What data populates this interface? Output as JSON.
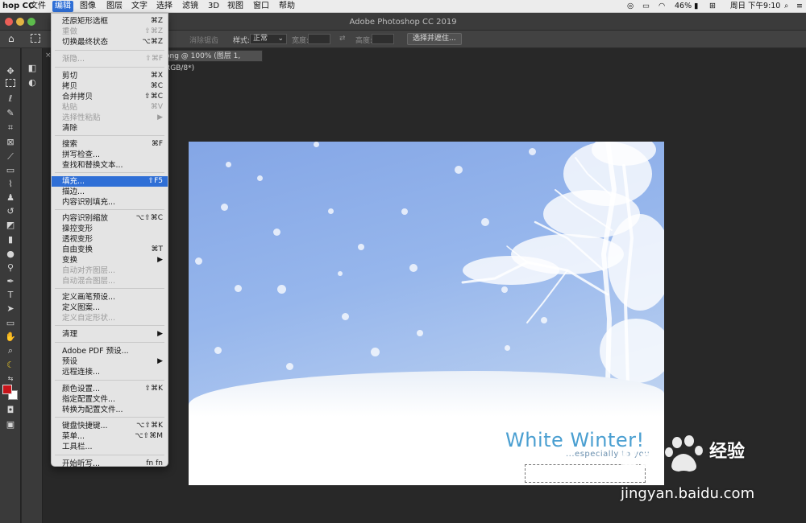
{
  "menubar": {
    "app": "hop CC",
    "items": [
      "文件",
      "编辑",
      "图像",
      "图层",
      "文字",
      "选择",
      "滤镜",
      "3D",
      "视图",
      "窗口",
      "帮助"
    ],
    "battery": "46%",
    "clock": "周日 下午9:10"
  },
  "window": {
    "title": "Adobe Photoshop CC 2019"
  },
  "options": {
    "style_label": "样式:",
    "style_value": "正常",
    "width_label": "宽度:",
    "height_label": "高度:",
    "select_mask_button": "选择并遮住...",
    "antialias_label": "消除锯齿"
  },
  "document_tab": {
    "label": "ong @ 100% (图层 1, RGB/8*)",
    "close": "×"
  },
  "edit_menu": {
    "items": [
      {
        "label": "还原矩形选框",
        "shortcut": "⌘Z",
        "disabled": false
      },
      {
        "label": "重做",
        "shortcut": "⇧⌘Z",
        "disabled": true
      },
      {
        "label": "切换最终状态",
        "shortcut": "⌥⌘Z",
        "disabled": false
      },
      {
        "label": "渐隐...",
        "shortcut": "⇧⌘F",
        "disabled": true
      },
      {
        "label": "剪切",
        "shortcut": "⌘X",
        "disabled": false
      },
      {
        "label": "拷贝",
        "shortcut": "⌘C",
        "disabled": false
      },
      {
        "label": "合并拷贝",
        "shortcut": "⇧⌘C",
        "disabled": false
      },
      {
        "label": "粘贴",
        "shortcut": "⌘V",
        "disabled": true
      },
      {
        "label": "选择性粘贴",
        "shortcut": "▶",
        "disabled": true
      },
      {
        "label": "清除",
        "shortcut": "",
        "disabled": false
      },
      {
        "label": "搜索",
        "shortcut": "⌘F",
        "disabled": false
      },
      {
        "label": "拼写检查...",
        "shortcut": "",
        "disabled": false
      },
      {
        "label": "查找和替换文本...",
        "shortcut": "",
        "disabled": false
      },
      {
        "label": "填充...",
        "shortcut": "⇧F5",
        "disabled": false,
        "highlighted": true
      },
      {
        "label": "描边...",
        "shortcut": "",
        "disabled": false
      },
      {
        "label": "内容识别填充...",
        "shortcut": "",
        "disabled": false
      },
      {
        "label": "内容识别缩放",
        "shortcut": "⌥⇧⌘C",
        "disabled": false
      },
      {
        "label": "操控变形",
        "shortcut": "",
        "disabled": false
      },
      {
        "label": "透视变形",
        "shortcut": "",
        "disabled": false
      },
      {
        "label": "自由变换",
        "shortcut": "⌘T",
        "disabled": false
      },
      {
        "label": "变换",
        "shortcut": "▶",
        "disabled": false
      },
      {
        "label": "自动对齐图层...",
        "shortcut": "",
        "disabled": true
      },
      {
        "label": "自动混合图层...",
        "shortcut": "",
        "disabled": true
      },
      {
        "label": "定义画笔预设...",
        "shortcut": "",
        "disabled": false
      },
      {
        "label": "定义图案...",
        "shortcut": "",
        "disabled": false
      },
      {
        "label": "定义自定形状...",
        "shortcut": "",
        "disabled": true
      },
      {
        "label": "清理",
        "shortcut": "▶",
        "disabled": false
      },
      {
        "label": "Adobe PDF 预设...",
        "shortcut": "",
        "disabled": false
      },
      {
        "label": "预设",
        "shortcut": "▶",
        "disabled": false
      },
      {
        "label": "远程连接...",
        "shortcut": "",
        "disabled": false
      },
      {
        "label": "颜色设置...",
        "shortcut": "⇧⌘K",
        "disabled": false
      },
      {
        "label": "指定配置文件...",
        "shortcut": "",
        "disabled": false
      },
      {
        "label": "转换为配置文件...",
        "shortcut": "",
        "disabled": false
      },
      {
        "label": "键盘快捷键...",
        "shortcut": "⌥⇧⌘K",
        "disabled": false
      },
      {
        "label": "菜单...",
        "shortcut": "⌥⇧⌘M",
        "disabled": false
      },
      {
        "label": "工具栏...",
        "shortcut": "",
        "disabled": false
      },
      {
        "label": "开始听写...",
        "shortcut": "fn fn",
        "disabled": false
      }
    ]
  },
  "artwork": {
    "headline": "White Winter!",
    "tagline": "...especially to you"
  },
  "watermark": {
    "brand": "经验",
    "url": "jingyan.baidu.com"
  },
  "colors": {
    "foreground": "#c8141a",
    "background": "#ffffff",
    "menu_highlight": "#2f6fd6"
  }
}
